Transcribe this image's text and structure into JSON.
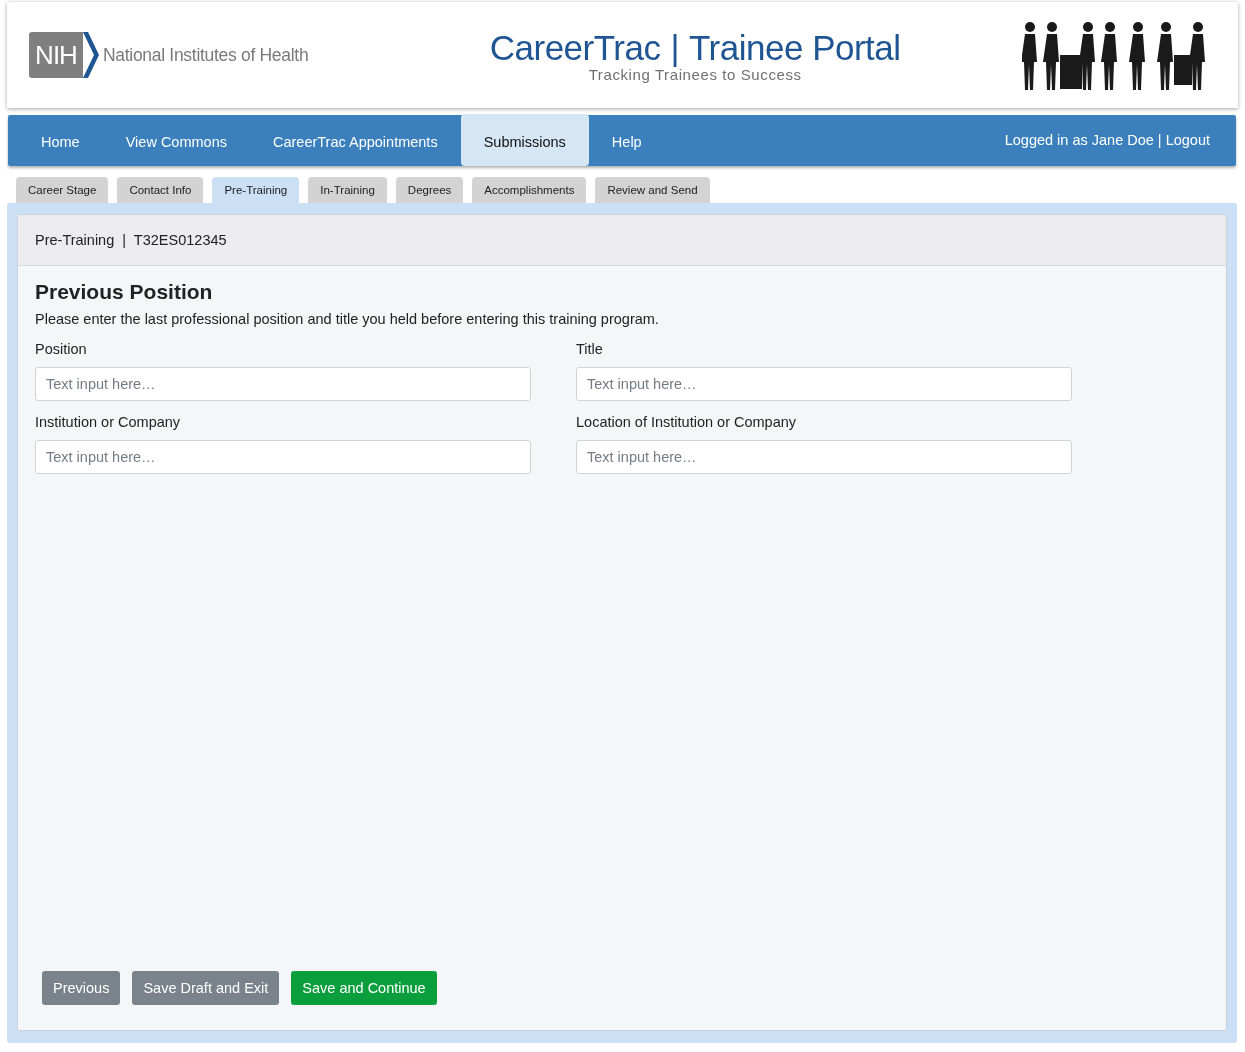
{
  "header": {
    "logo": {
      "mark": "NIH",
      "org": "National Institutes of Health"
    },
    "title": {
      "left": "CareerTrac",
      "separator": "|",
      "right": "Trainee Portal",
      "tagline": "Tracking Trainees to Success"
    }
  },
  "nav": {
    "items": [
      {
        "label": "Home",
        "selected": false
      },
      {
        "label": "View Commons",
        "selected": false
      },
      {
        "label": "CareerTrac Appointments",
        "selected": false
      },
      {
        "label": "Submissions",
        "selected": true
      },
      {
        "label": "Help",
        "selected": false
      }
    ],
    "user": {
      "text": "Logged in as Jane Doe",
      "separator": "|",
      "logout": "Logout"
    }
  },
  "tabs": [
    {
      "label": "Career Stage",
      "selected": false
    },
    {
      "label": "Contact Info",
      "selected": false
    },
    {
      "label": "Pre-Training",
      "selected": true
    },
    {
      "label": "In-Training",
      "selected": false
    },
    {
      "label": "Degrees",
      "selected": false
    },
    {
      "label": "Accomplishments",
      "selected": false
    },
    {
      "label": "Review and Send",
      "selected": false
    }
  ],
  "panel": {
    "heading": "Pre-Training  |  T32ES012345",
    "title": "Previous Position",
    "intro": "Please enter the last professional position and title you held before entering this training program.",
    "fields": [
      {
        "label": "Position",
        "placeholder": "Text input here…"
      },
      {
        "label": "Title",
        "placeholder": "Text input here…"
      },
      {
        "label": "Institution or Company",
        "placeholder": "Text input here…"
      },
      {
        "label": "Location of Institution or Company",
        "placeholder": "Text input here…"
      }
    ],
    "buttons": [
      {
        "label": "Previous",
        "kind": "secondary"
      },
      {
        "label": "Save Draft and Exit",
        "kind": "secondary"
      },
      {
        "label": "Save and Continue",
        "kind": "primary"
      }
    ]
  }
}
